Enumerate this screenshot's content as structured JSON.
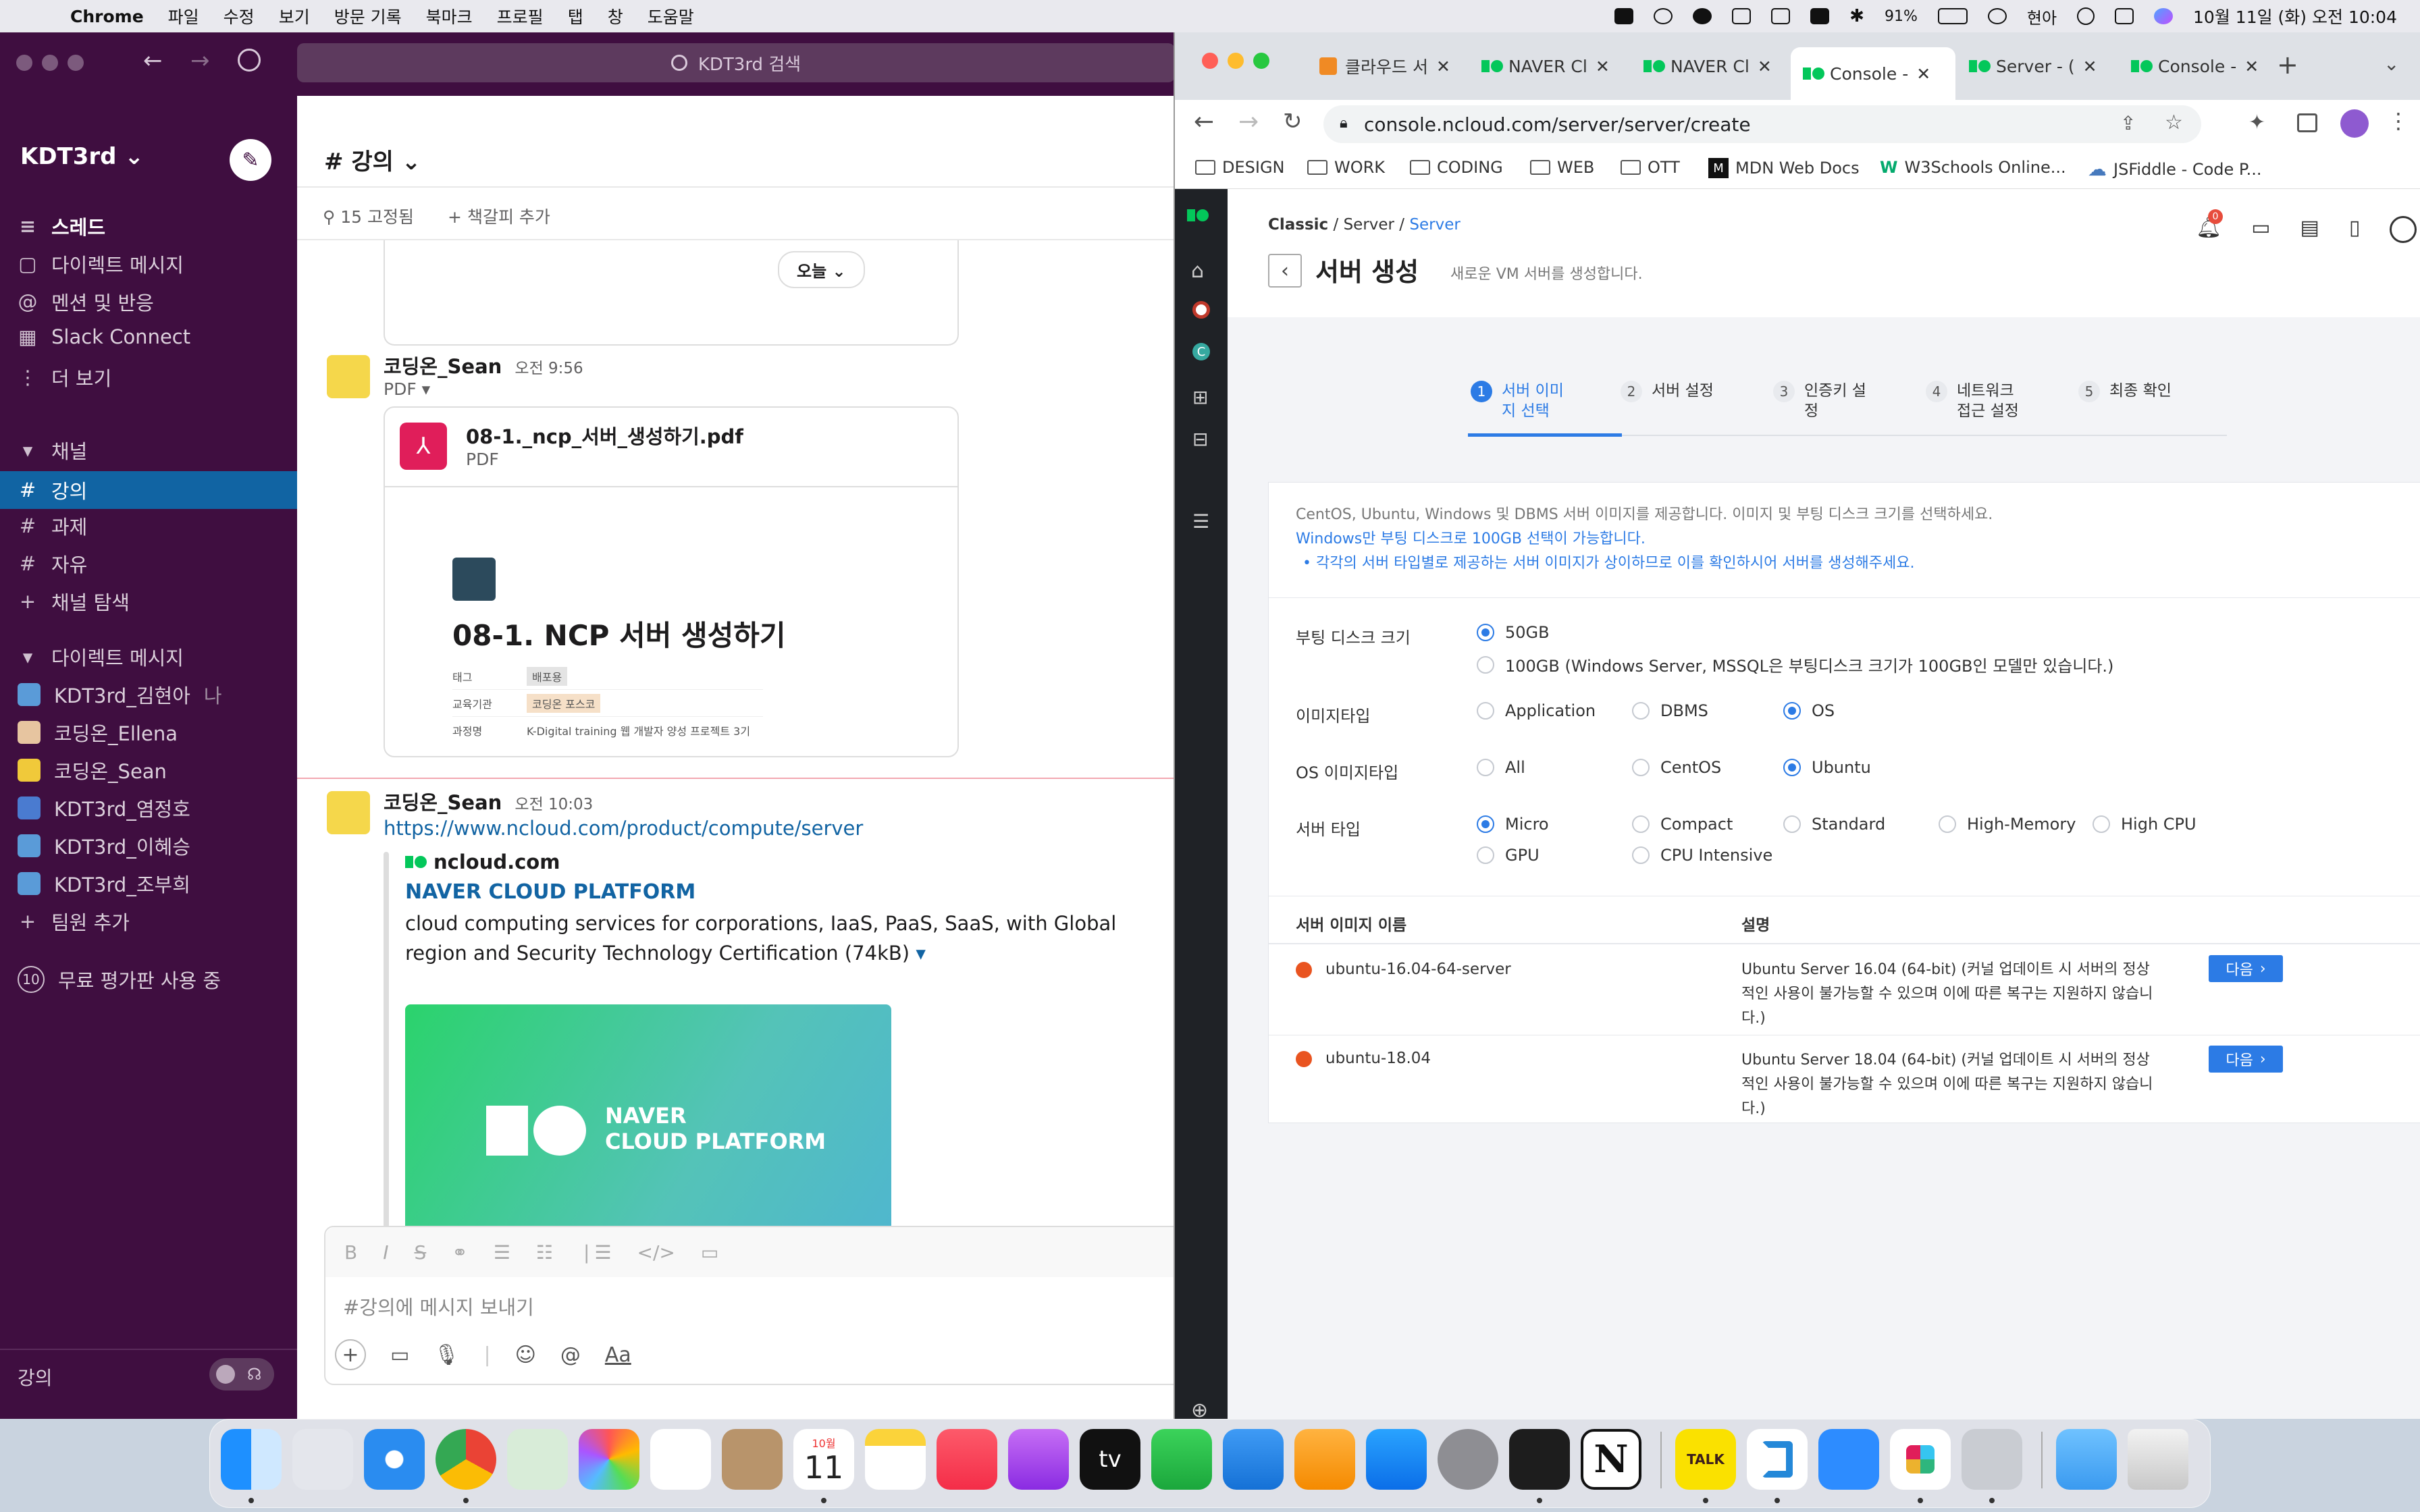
{
  "menubar": {
    "app": "Chrome",
    "menus": [
      "파일",
      "수정",
      "보기",
      "방문 기록",
      "북마크",
      "프로필",
      "탭",
      "창",
      "도움말"
    ],
    "battery": "91%",
    "user": "현아",
    "datetime": "10월 11일 (화) 오전 10:04"
  },
  "slack": {
    "search_placeholder": "KDT3rd 검색",
    "workspace": "KDT3rd",
    "nav": [
      "스레드",
      "다이렉트 메시지",
      "멘션 및 반응",
      "Slack Connect",
      "더 보기"
    ],
    "channels_header": "채널",
    "channels": [
      "강의",
      "과제",
      "자유"
    ],
    "browse_channels": "채널 탐색",
    "dm_header": "다이렉트 메시지",
    "dms": [
      {
        "name": "KDT3rd_김현아",
        "suffix": "나"
      },
      {
        "name": "코딩온_Ellena",
        "suffix": ""
      },
      {
        "name": "코딩온_Sean",
        "suffix": ""
      },
      {
        "name": "KDT3rd_염정호",
        "suffix": ""
      },
      {
        "name": "KDT3rd_이혜승",
        "suffix": ""
      },
      {
        "name": "KDT3rd_조부희",
        "suffix": ""
      }
    ],
    "add_member": "팀원 추가",
    "trial_badge": "10",
    "trial": "무료 평가판 사용 중",
    "footer_channel": "강의",
    "channel_title": "# 강의",
    "pinned": "15 고정됨",
    "add_bookmark": "책갈피 추가",
    "today_chip": "오늘",
    "message1": {
      "author": "코딩온_Sean",
      "time": "오전 9:56",
      "type_label": "PDF",
      "file_name": "08-1._ncp_서버_생성하기.pdf",
      "file_type": "PDF",
      "preview_title": "08-1. NCP 서버 생성하기",
      "preview_rows": [
        {
          "k": "태그",
          "v": "배포용"
        },
        {
          "k": "교육기관",
          "v": "코딩온   포스코"
        },
        {
          "k": "과정명",
          "v": "K-Digital training 웹 개발자 양성 프로젝트 3기"
        }
      ]
    },
    "message2": {
      "author": "코딩온_Sean",
      "time": "오전 10:03",
      "link": "https://www.ncloud.com/product/compute/server",
      "site": "ncloud.com",
      "unfurl_title": "NAVER CLOUD PLATFORM",
      "unfurl_desc": "cloud computing services for corporations, IaaS, PaaS, SaaS, with Global region and Security Technology Certification (74kB)",
      "banner_line1": "NAVER",
      "banner_line2": "CLOUD PLATFORM"
    },
    "composer_placeholder": "#강의에 메시지 보내기",
    "composer_aa": "Aa"
  },
  "chrome": {
    "tabs": [
      {
        "title": "클라우드 서",
        "active": false
      },
      {
        "title": "NAVER Cl",
        "active": false
      },
      {
        "title": "NAVER Cl",
        "active": false
      },
      {
        "title": "Console -",
        "active": true
      },
      {
        "title": "Server - (",
        "active": false
      },
      {
        "title": "Console -",
        "active": false
      }
    ],
    "url": "console.ncloud.com/server/server/create",
    "bookmarks": [
      "DESIGN",
      "WORK",
      "CODING",
      "WEB",
      "OTT",
      "MDN Web Docs",
      "W3Schools Online...",
      "JSFiddle - Code P..."
    ]
  },
  "ncp": {
    "breadcrumb": [
      "Classic",
      "Server",
      "Server"
    ],
    "title": "서버 생성",
    "subtitle": "새로운 VM 서버를 생성합니다.",
    "notif_count": "0",
    "steps": [
      {
        "n": "1",
        "label": "서버 이미\n지 선택",
        "active": true
      },
      {
        "n": "2",
        "label": "서버 설정",
        "active": false
      },
      {
        "n": "3",
        "label": "인증키 설\n정",
        "active": false
      },
      {
        "n": "4",
        "label": "네트워크\n접근 설정",
        "active": false
      },
      {
        "n": "5",
        "label": "최종 확인",
        "active": false
      }
    ],
    "info1": "CentOS, Ubuntu, Windows 및 DBMS 서버 이미지를 제공합니다. 이미지 및 부팅 디스크 크기를 선택하세요.",
    "info2": "Windows만 부팅 디스크로 100GB 선택이 가능합니다.",
    "info3": "각각의 서버 타입별로 제공하는 서버 이미지가 상이하므로 이를 확인하시어 서버를 생성해주세요.",
    "boot_label": "부팅 디스크 크기",
    "boot_opt1": "50GB",
    "boot_opt2": "100GB (Windows Server, MSSQL은 부팅디스크 크기가 100GB인 모델만 있습니다.)",
    "image_type_label": "이미지타입",
    "image_types": [
      "Application",
      "DBMS",
      "OS"
    ],
    "os_type_label": "OS 이미지타입",
    "os_types": [
      "All",
      "CentOS",
      "Ubuntu"
    ],
    "server_type_label": "서버 타입",
    "server_types": [
      "Micro",
      "Compact",
      "Standard",
      "High-Memory",
      "High CPU",
      "GPU",
      "CPU Intensive"
    ],
    "table_head": [
      "서버 이미지 이름",
      "설명"
    ],
    "rows": [
      {
        "name": "ubuntu-16.04-64-server",
        "desc": "Ubuntu Server 16.04 (64-bit) (커널 업데이트 시 서버의 정상적인 사용이 불가능할 수 있으며 이에 따른 복구는 지원하지 않습니다.)",
        "btn": "다음"
      },
      {
        "name": "ubuntu-18.04",
        "desc": "Ubuntu Server 18.04 (64-bit) (커널 업데이트 시 서버의 정상적인 사용이 불가능할 수 있으며 이에 따른 복구는 지원하지 않습니다.)",
        "btn": "다음"
      }
    ]
  },
  "dock": {
    "calendar_month": "10월",
    "calendar_day": "11",
    "talk": "TALK",
    "tv": "tv",
    "notion": "N"
  }
}
